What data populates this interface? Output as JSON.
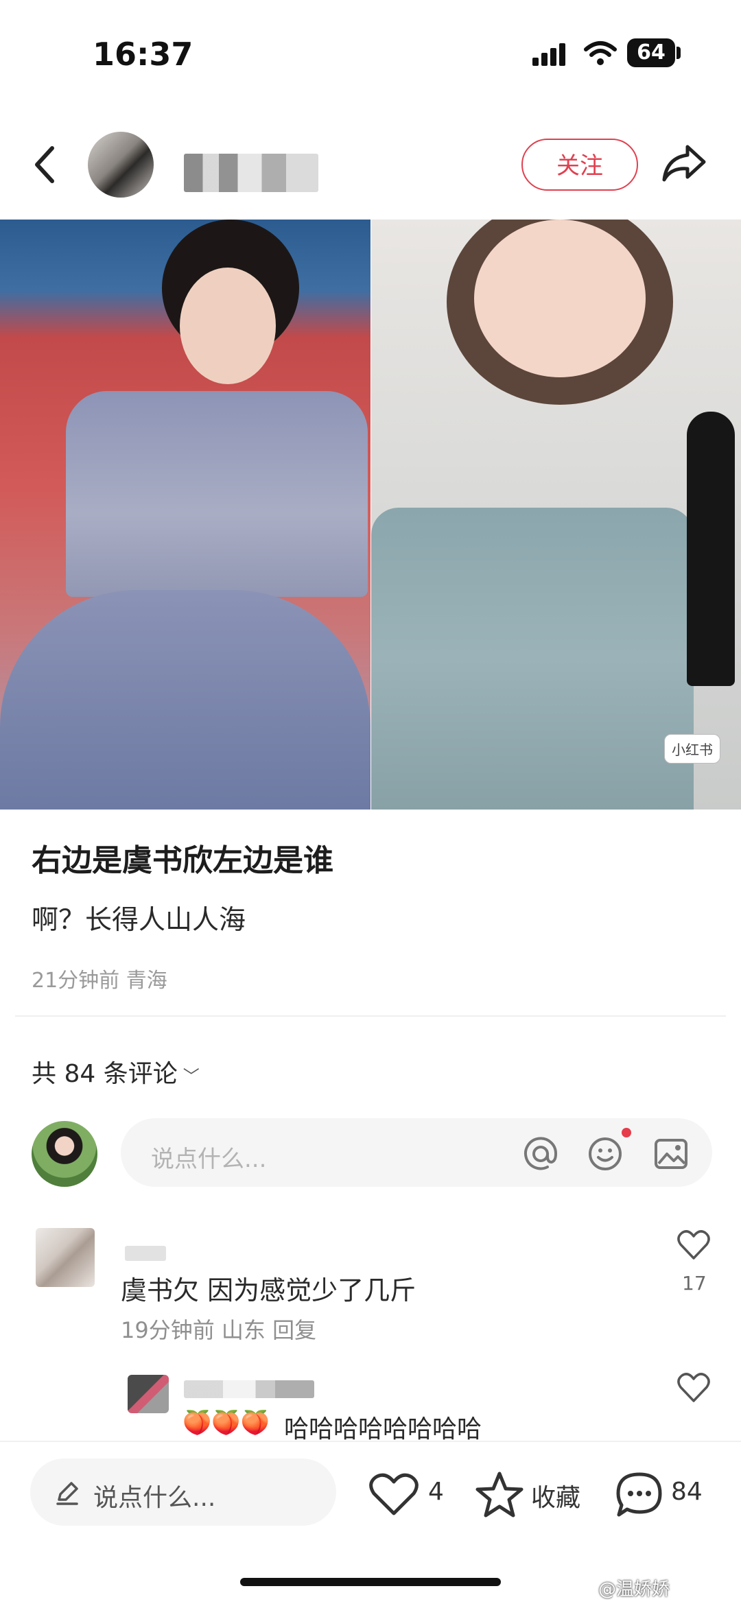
{
  "status_bar": {
    "time": "16:37",
    "battery": "64"
  },
  "header": {
    "follow_label": "关注"
  },
  "post": {
    "title": "右边是虞书欣左边是谁",
    "body": "啊？长得人山人海",
    "meta": "21分钟前 青海",
    "photo_watermark": "小红书"
  },
  "comments_section": {
    "count_label": "共 84 条评论",
    "input_placeholder": "说点什么..."
  },
  "comments": [
    {
      "text": "虞书欠  因为感觉少了几斤",
      "meta": "19分钟前 山东 回复",
      "likes": "17"
    },
    {
      "emoji": "🍑🍑🍑",
      "text": "哈哈哈哈哈哈哈哈"
    }
  ],
  "bottom_bar": {
    "input_placeholder": "说点什么...",
    "like_count": "4",
    "favorite_label": "收藏",
    "comment_count": "84"
  },
  "overlay": {
    "weibo_watermark": "@温娇娇"
  },
  "icons": {
    "back": "chevron-left-icon",
    "share": "share-arrow-icon",
    "at": "at-icon",
    "emoji": "smiley-icon",
    "image": "image-icon",
    "like": "heart-icon",
    "favorite": "star-icon",
    "comment": "chat-bubble-icon",
    "edit": "pencil-icon"
  },
  "colors": {
    "accent": "#e0404f"
  }
}
